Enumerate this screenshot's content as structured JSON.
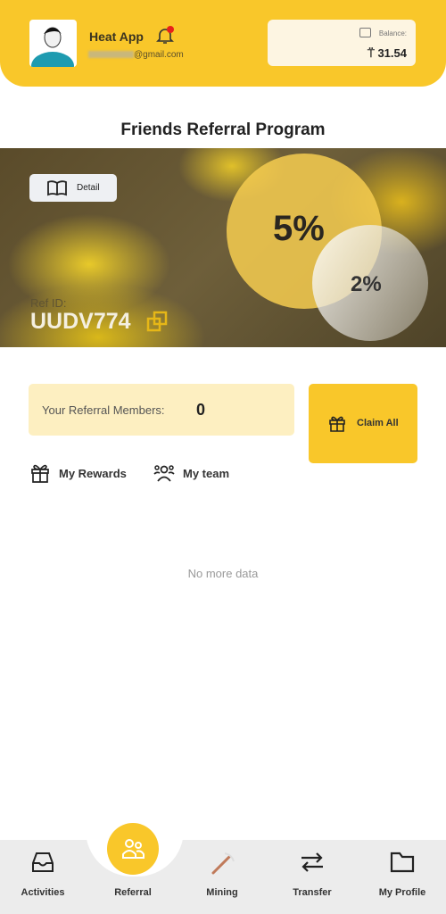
{
  "header": {
    "app_name": "Heat App",
    "email_visible": "@gmail.com",
    "balance_label": "Balance:",
    "balance_value": "31.54",
    "accent": "#f9c72a",
    "notification_dot": true
  },
  "page": {
    "title": "Friends Referral Program"
  },
  "banner": {
    "detail_label": "Detail",
    "level1_rate": "5%",
    "level2_rate": "2%",
    "ref_id_label": "Ref ID:",
    "ref_id": "UUDV774"
  },
  "referral": {
    "members_label": "Your Referral Members:",
    "members_count": "0",
    "claim_label": "Claim All"
  },
  "tabs": [
    {
      "label": "My Rewards",
      "icon": "gift-icon"
    },
    {
      "label": "My team",
      "icon": "team-icon"
    }
  ],
  "empty_text": "No more data",
  "nav": [
    {
      "label": "Activities",
      "icon": "inbox-icon"
    },
    {
      "label": "Referral",
      "icon": "users-icon",
      "active": true
    },
    {
      "label": "Mining",
      "icon": "pickaxe-icon"
    },
    {
      "label": "Transfer",
      "icon": "arrows-icon"
    },
    {
      "label": "My Profile",
      "icon": "folder-icon"
    }
  ]
}
